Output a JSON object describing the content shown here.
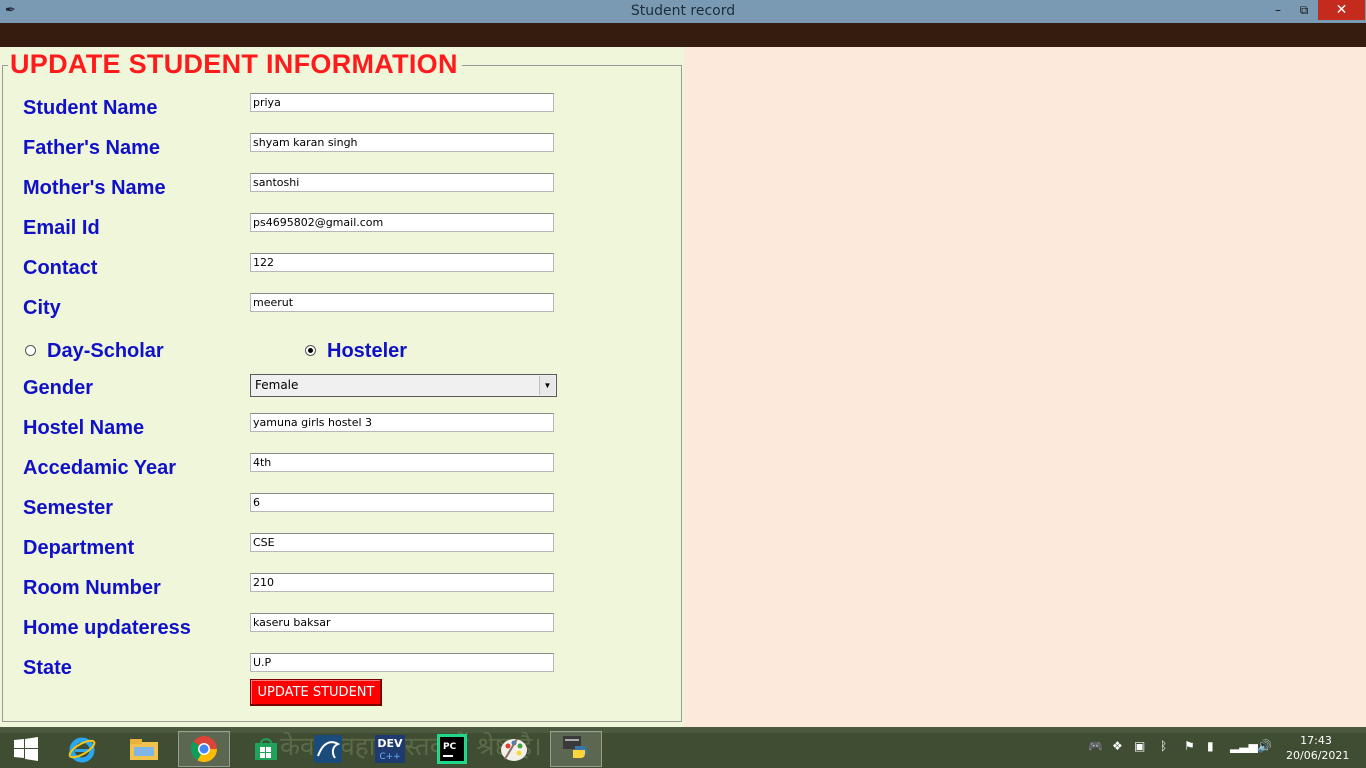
{
  "window": {
    "title": "Student record",
    "controls": {
      "minimize": "–",
      "maximize": "⧉",
      "close": "✕"
    }
  },
  "form": {
    "legend": "UPDATE STUDENT INFORMATION",
    "fields": [
      {
        "label": "Student Name",
        "value": "priya"
      },
      {
        "label": "Father's Name",
        "value": "shyam karan singh"
      },
      {
        "label": "Mother's Name",
        "value": "santoshi"
      },
      {
        "label": "Email Id",
        "value": "ps4695802@gmail.com"
      },
      {
        "label": "Contact",
        "value": "122"
      },
      {
        "label": "City",
        "value": "meerut"
      }
    ],
    "radio": {
      "day_scholar": {
        "label": "Day-Scholar",
        "selected": false
      },
      "hosteler": {
        "label": "Hosteler",
        "selected": true
      }
    },
    "gender": {
      "label": "Gender",
      "value": "Female"
    },
    "fields2": [
      {
        "label": "Hostel Name",
        "value": "yamuna girls hostel 3"
      },
      {
        "label": "Accedamic Year",
        "value": "4th"
      },
      {
        "label": "Semester",
        "value": "6"
      },
      {
        "label": "Department",
        "value": "CSE"
      },
      {
        "label": "Room Number",
        "value": "210"
      },
      {
        "label": "Home updateress",
        "value": "kaseru baksar"
      },
      {
        "label": "State",
        "value": "U.P"
      }
    ],
    "submit_label": "UPDATE STUDENT"
  },
  "taskbar": {
    "apps": [
      "start",
      "internet-explorer",
      "file-explorer",
      "chrome",
      "store",
      "mysql-workbench",
      "dev-cpp",
      "pycharm",
      "paint",
      "python-idle"
    ],
    "active_app": "python-idle",
    "wallpaper_text": "केवल वहा वास्तव में श्रेष्ठ है।",
    "clock_time": "17:43",
    "clock_date": "20/06/2021"
  },
  "colors": {
    "label": "#1010c8",
    "legend": "#ff1b1b",
    "button": "#ff0000",
    "panel": "#eff6da",
    "background": "#fde9dc"
  }
}
